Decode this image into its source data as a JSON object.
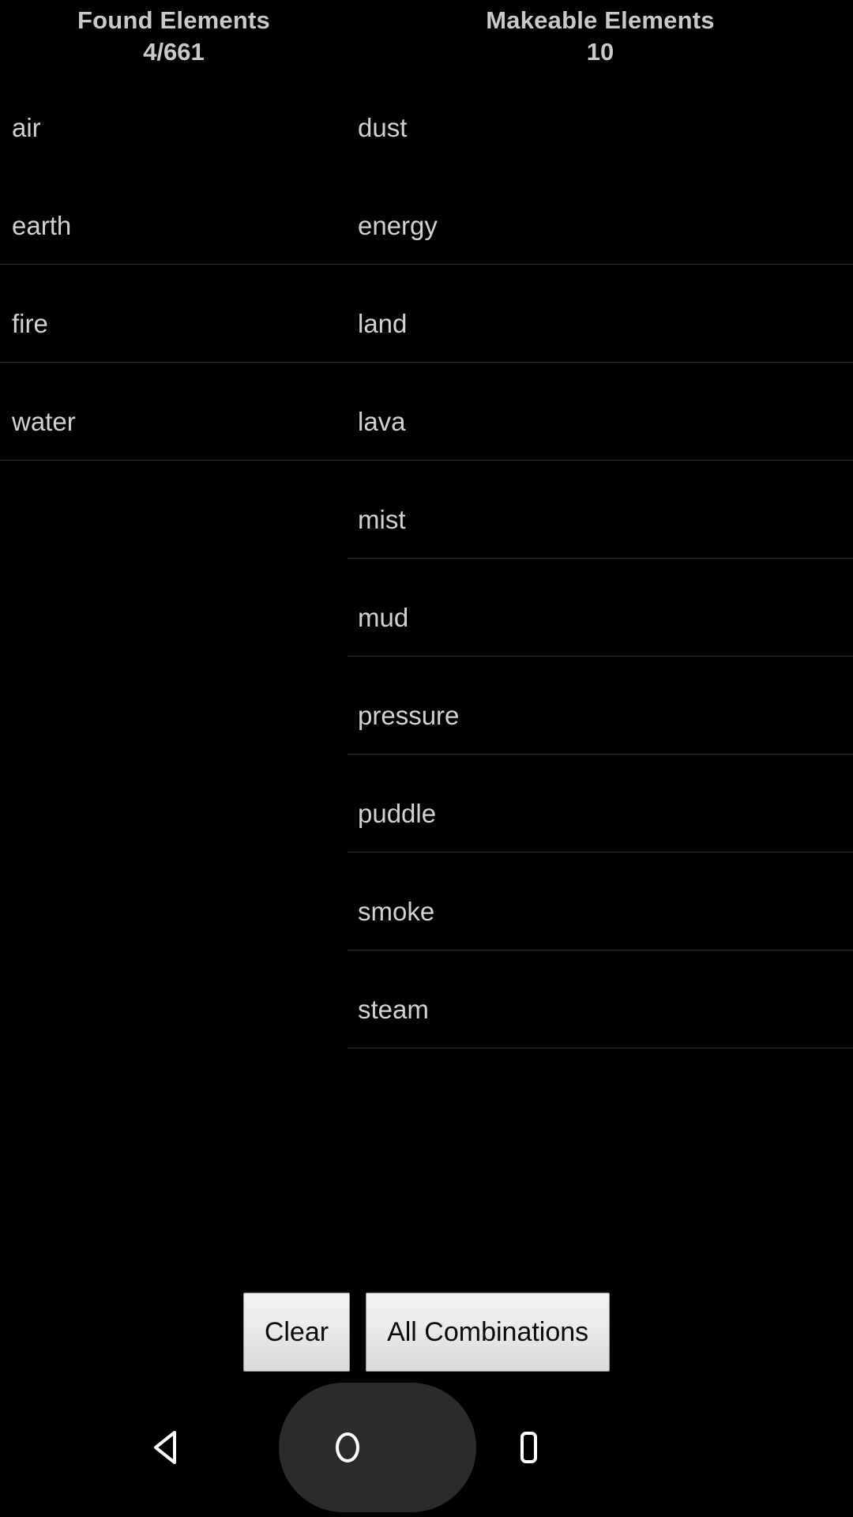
{
  "app": {
    "background_color": "#000000",
    "text_color": "#d2d2d2",
    "separator_color": "#343434"
  },
  "columns": {
    "found": {
      "header_title": "Found Elements",
      "header_count": "4/661",
      "items": [
        {
          "label": "air"
        },
        {
          "label": "earth"
        },
        {
          "label": "fire"
        },
        {
          "label": "water"
        }
      ]
    },
    "makeable": {
      "header_title": "Makeable Elements",
      "header_count": "10",
      "items": [
        {
          "label": "dust"
        },
        {
          "label": "energy"
        },
        {
          "label": "land"
        },
        {
          "label": "lava"
        },
        {
          "label": "mist"
        },
        {
          "label": "mud"
        },
        {
          "label": "pressure"
        },
        {
          "label": "puddle"
        },
        {
          "label": "smoke"
        },
        {
          "label": "steam"
        }
      ]
    }
  },
  "buttons": {
    "clear_label": "Clear",
    "all_combinations_label": "All Combinations",
    "face_color": "#eaeaea",
    "text_color": "#0a0a0a"
  },
  "navbar": {
    "back_label": "Back",
    "home_label": "Home",
    "recents_label": "Recents",
    "highlight_color": "#2b2b2b",
    "icon_color": "#ffffff"
  }
}
